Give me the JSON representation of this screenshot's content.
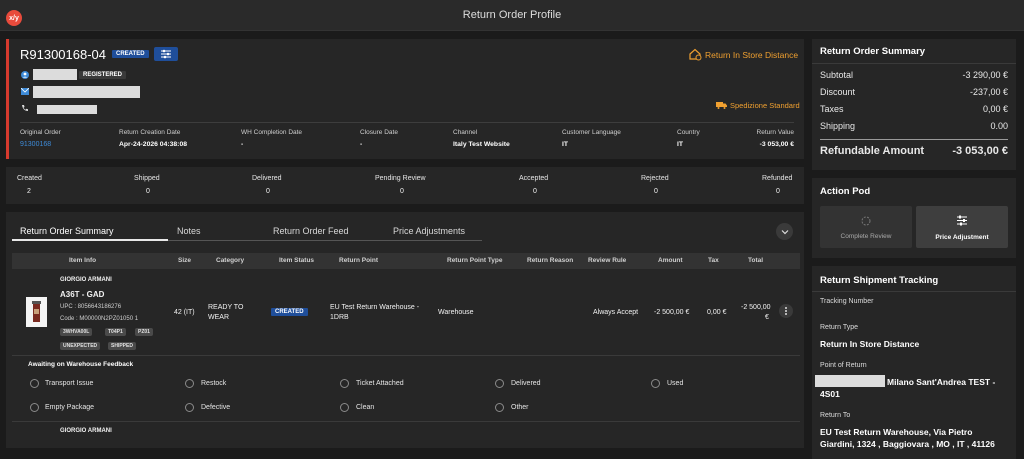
{
  "app": {
    "title": "Return Order Profile",
    "logo_text": "x/y"
  },
  "order": {
    "id": "R91300168-04",
    "status_badge": "CREATED",
    "customer_tag": "REGISTERED",
    "return_method": "Return In Store Distance",
    "shipping_method": "Spedizione Standard",
    "fields": [
      {
        "label": "Original Order",
        "value": "91300168"
      },
      {
        "label": "Return Creation Date",
        "value": "Apr-24-2026 04:38:08"
      },
      {
        "label": "WH Completion Date",
        "value": "-"
      },
      {
        "label": "Closure Date",
        "value": "-"
      },
      {
        "label": "Channel",
        "value": "Italy Test Website"
      },
      {
        "label": "Customer Language",
        "value": "IT"
      },
      {
        "label": "Country",
        "value": "IT"
      },
      {
        "label": "Return Value",
        "value": "-3 053,00 €"
      }
    ]
  },
  "status_counts": [
    {
      "label": "Created",
      "value": "2"
    },
    {
      "label": "Shipped",
      "value": "0"
    },
    {
      "label": "Delivered",
      "value": "0"
    },
    {
      "label": "Pending Review",
      "value": "0"
    },
    {
      "label": "Accepted",
      "value": "0"
    },
    {
      "label": "Rejected",
      "value": "0"
    },
    {
      "label": "Refunded",
      "value": "0"
    }
  ],
  "tabs": [
    "Return Order Summary",
    "Notes",
    "Return Order Feed",
    "Price Adjustments"
  ],
  "table": {
    "headers": [
      "Item Info",
      "Size",
      "Category",
      "Item Status",
      "Return Point",
      "Return Point Type",
      "Return Reason",
      "Review Rule",
      "Amount",
      "Tax",
      "Total"
    ],
    "row": {
      "brand": "GIORGIO ARMANI",
      "name": "A36T - GAD",
      "upc": "UPC : 8056643186276",
      "code": "Code : M00000N2PZ01050 1",
      "tags": [
        "3WHVA00L",
        "T04P1",
        "PZ01"
      ],
      "flags": [
        "UNEXPECTED",
        "SHIPPED"
      ],
      "size": "42 (IT)",
      "category_line1": "READY TO",
      "category_line2": "WEAR",
      "status": "CREATED",
      "return_point_line1": "EU Test Return Warehouse -",
      "return_point_line2": "1DRB",
      "return_point_type": "Warehouse",
      "return_reason": "",
      "review_rule": "Always Accept",
      "amount": "-2 500,00 €",
      "tax": "0,00 €",
      "total_line1": "-2 500,00",
      "total_line2": "€"
    },
    "feedback_title": "Awaiting on Warehouse Feedback",
    "feedback_options": [
      "Transport Issue",
      "Restock",
      "Ticket Attached",
      "Delivered",
      "Used",
      "Empty Package",
      "Defective",
      "Clean",
      "Other"
    ],
    "next_brand": "GIORGIO ARMANI"
  },
  "summary": {
    "title": "Return Order Summary",
    "subtotal_label": "Subtotal",
    "subtotal": "-3 290,00 €",
    "discount_label": "Discount",
    "discount": "-237,00 €",
    "taxes_label": "Taxes",
    "taxes": "0,00 €",
    "shipping_label": "Shipping",
    "shipping": "0.00",
    "refundable_label": "Refundable Amount",
    "refundable": "-3 053,00 €"
  },
  "action_pod": {
    "title": "Action Pod",
    "complete_review": "Complete Review",
    "price_adjustment": "Price Adjustment"
  },
  "tracking": {
    "title": "Return Shipment Tracking",
    "tracking_number_label": "Tracking Number",
    "return_type_label": "Return Type",
    "return_type": "Return In Store Distance",
    "point_label": "Point of Return",
    "point_line1": "Milano Sant'Andrea TEST -",
    "point_line2": "4S01",
    "return_to_label": "Return To",
    "return_to_line1": "EU Test Return Warehouse, Via Pietro",
    "return_to_line2": "Giardini, 1324 , Baggiovara , MO , IT , 41126"
  },
  "colors": {
    "accent_blue": "#1f4e9a",
    "orange": "#f0a030",
    "red_bar": "#d63a2e",
    "link_blue": "#3e8bd8"
  }
}
